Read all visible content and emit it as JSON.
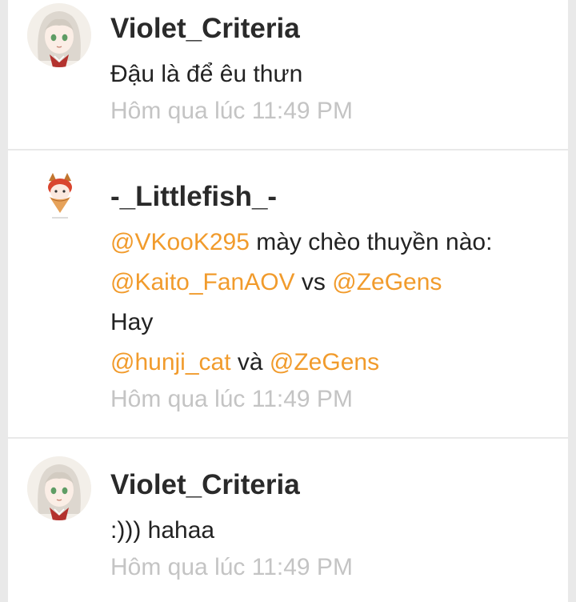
{
  "comments": [
    {
      "username": "Violet_Criteria",
      "avatar_icon": "anime-girl-avatar-icon",
      "message": "Đậu là để êu thưn",
      "timestamp": "Hôm qua lúc 11:49 PM"
    },
    {
      "username": "-_Littlefish_-",
      "avatar_icon": "cat-girl-avatar-icon",
      "lines": {
        "l1_mention": "@VKooK295",
        "l1_text": " mày chèo thuyền nào:",
        "l2_mention1": "@Kaito_FanAOV",
        "l2_text": " vs ",
        "l2_mention2": "@ZeGens",
        "l3_text": "Hay",
        "l4_mention1": "@hunji_cat",
        "l4_text": " và ",
        "l4_mention2": "@ZeGens"
      },
      "timestamp": "Hôm qua lúc 11:49 PM"
    },
    {
      "username": "Violet_Criteria",
      "avatar_icon": "anime-girl-avatar-icon",
      "message": ":))) hahaa",
      "timestamp": "Hôm qua lúc 11:49 PM"
    }
  ],
  "colors": {
    "mention": "#f19b2c",
    "username": "#2a2a2a",
    "timestamp": "#c4c4c4",
    "separator": "#e9e9e9"
  }
}
